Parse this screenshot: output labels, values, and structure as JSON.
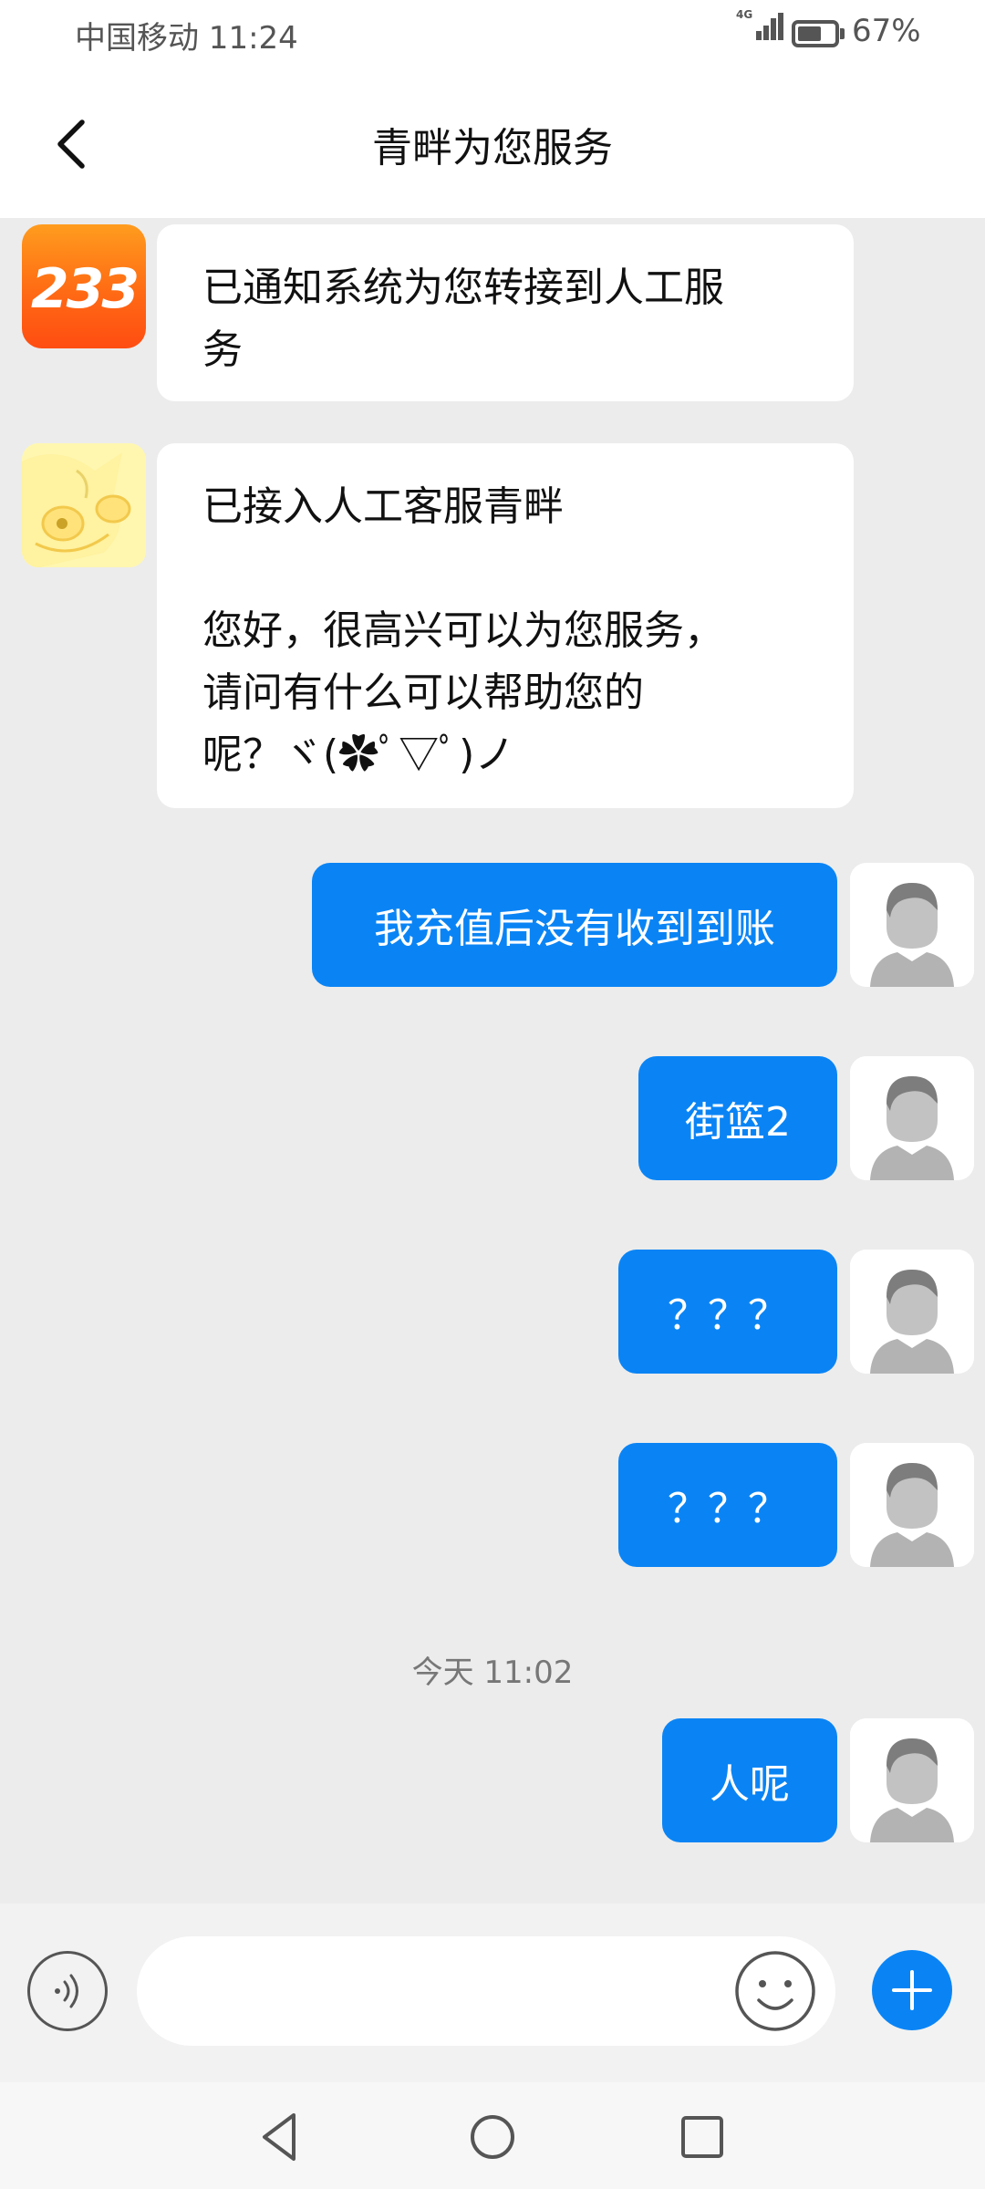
{
  "status_bar": {
    "carrier_time": "中国移动 11:24",
    "network": "4G",
    "battery": "67%",
    "battery_level": 0.67
  },
  "header": {
    "back_icon": "chevron-left-icon",
    "title": "青畔为您服务"
  },
  "messages": [
    {
      "side": "in",
      "avatar": "233-logo",
      "avatar_text": "233",
      "text": "已通知系统为您转接到人工服\n务"
    },
    {
      "side": "in",
      "avatar": "anime-avatar",
      "text": "已接入人工客服青畔\n\n您好，很高兴可以为您服务，\n请问有什么可以帮助您的\n呢？ヾ(✿ﾟ▽ﾟ)ノ"
    },
    {
      "side": "out",
      "avatar": "default-user-avatar",
      "text": "我充值后没有收到到账"
    },
    {
      "side": "out",
      "avatar": "default-user-avatar",
      "text": "街篮2"
    },
    {
      "side": "out",
      "avatar": "default-user-avatar",
      "text": "？？？"
    },
    {
      "side": "out",
      "avatar": "default-user-avatar",
      "text": "？？？"
    },
    {
      "side": "out",
      "avatar": "default-user-avatar",
      "text": "人呢"
    }
  ],
  "timestamp": "今天  11:02",
  "input": {
    "voice_icon": "voice-icon",
    "placeholder": "",
    "emoji_icon": "emoji-icon",
    "plus_icon": "plus-icon"
  },
  "nav": [
    "back-triangle-icon",
    "home-circle-icon",
    "recents-square-icon"
  ],
  "colors": {
    "accent": "#0a84f5",
    "background": "#ececec",
    "bubble_in": "#ffffff"
  }
}
